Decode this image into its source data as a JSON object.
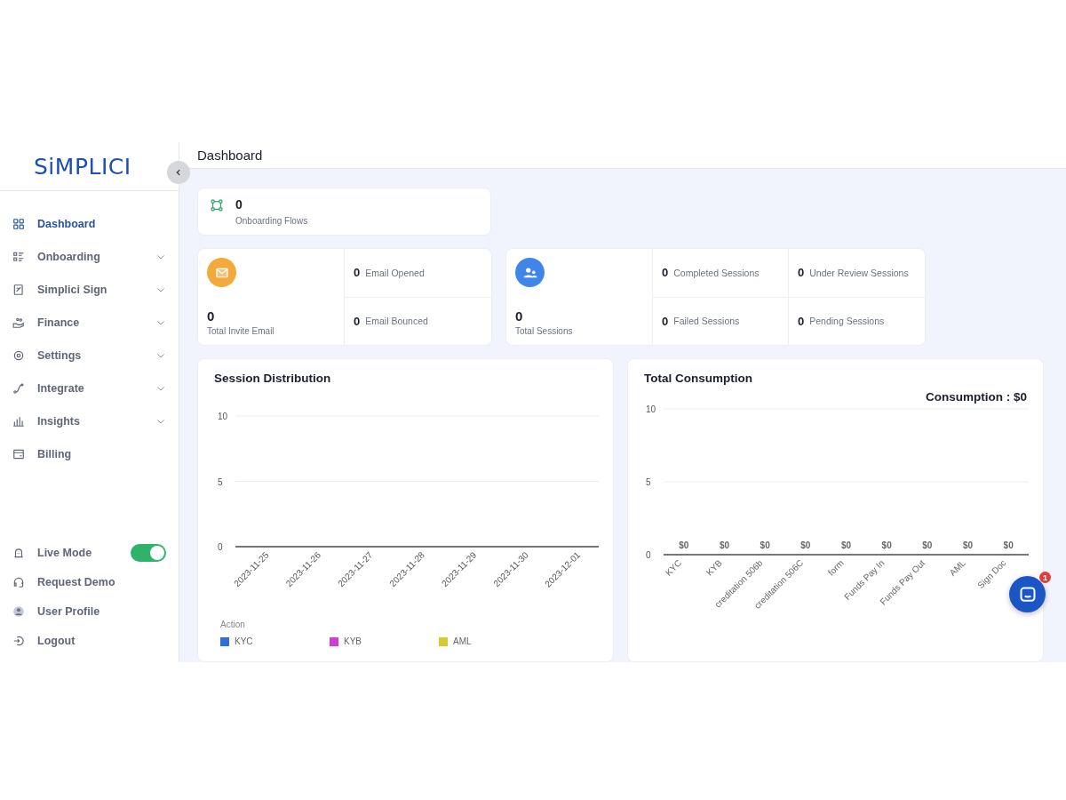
{
  "logo": "SiMPLICI",
  "header": {
    "title": "Dashboard"
  },
  "sidebar": {
    "items": [
      {
        "label": "Dashboard",
        "selected": true,
        "expandable": false
      },
      {
        "label": "Onboarding",
        "selected": false,
        "expandable": true
      },
      {
        "label": "Simplici Sign",
        "selected": false,
        "expandable": true
      },
      {
        "label": "Finance",
        "selected": false,
        "expandable": true
      },
      {
        "label": "Settings",
        "selected": false,
        "expandable": true
      },
      {
        "label": "Integrate",
        "selected": false,
        "expandable": true
      },
      {
        "label": "Insights",
        "selected": false,
        "expandable": true
      },
      {
        "label": "Billing",
        "selected": false,
        "expandable": false
      }
    ],
    "footer_items": [
      {
        "kind": "toggle",
        "label": "Live Mode",
        "on": true
      },
      {
        "kind": "link",
        "label": "Request Demo"
      },
      {
        "kind": "link",
        "label": "User Profile"
      },
      {
        "kind": "link",
        "label": "Logout"
      }
    ]
  },
  "onboarding_flows": {
    "value": "0",
    "label": "Onboarding Flows"
  },
  "email_stats": {
    "total": {
      "value": "0",
      "label": "Total Invite Email"
    },
    "items": [
      {
        "value": "0",
        "label": "Email Opened"
      },
      {
        "value": "0",
        "label": "Email Bounced"
      }
    ]
  },
  "session_stats": {
    "total": {
      "value": "0",
      "label": "Total Sessions"
    },
    "items": [
      {
        "value": "0",
        "label": "Completed Sessions"
      },
      {
        "value": "0",
        "label": "Under Review Sessions"
      },
      {
        "value": "0",
        "label": "Failed Sessions"
      },
      {
        "value": "0",
        "label": "Pending Sessions"
      }
    ]
  },
  "session_distribution": {
    "legend_title": "Action",
    "chart_data": {
      "type": "line",
      "title": "Session Distribution",
      "categories": [
        "2023-11-25",
        "2023-11-26",
        "2023-11-27",
        "2023-11-28",
        "2023-11-29",
        "2023-11-30",
        "2023-12-01"
      ],
      "ylim": [
        0,
        10
      ],
      "yticks": [
        0,
        5,
        10
      ],
      "series": [
        {
          "name": "KYC",
          "color": "#2f6fdc",
          "values": [
            null,
            null,
            null,
            null,
            null,
            null,
            null
          ]
        },
        {
          "name": "KYB",
          "color": "#d23bd6",
          "values": [
            null,
            null,
            null,
            null,
            null,
            null,
            null
          ]
        },
        {
          "name": "AML",
          "color": "#d9c934",
          "values": [
            null,
            null,
            null,
            null,
            null,
            null,
            null
          ]
        }
      ]
    }
  },
  "total_consumption": {
    "consumption": "Consumption : $0",
    "chart_data": {
      "type": "bar",
      "title": "Total Consumption",
      "categories": [
        "KYC",
        "KYB",
        "creditation 506b",
        "creditation 506C",
        "form",
        "Funds Pay In",
        "Funds Pay Out",
        "AML",
        "Sign Doc"
      ],
      "values": [
        0,
        0,
        0,
        0,
        0,
        0,
        0,
        0,
        0
      ],
      "ylim": [
        0,
        10
      ],
      "yticks": [
        0,
        5,
        10
      ],
      "value_labels": [
        "$0",
        "$0",
        "$0",
        "$0",
        "$0",
        "$0",
        "$0",
        "$0",
        "$0"
      ]
    }
  },
  "chat": {
    "badge": "1"
  }
}
